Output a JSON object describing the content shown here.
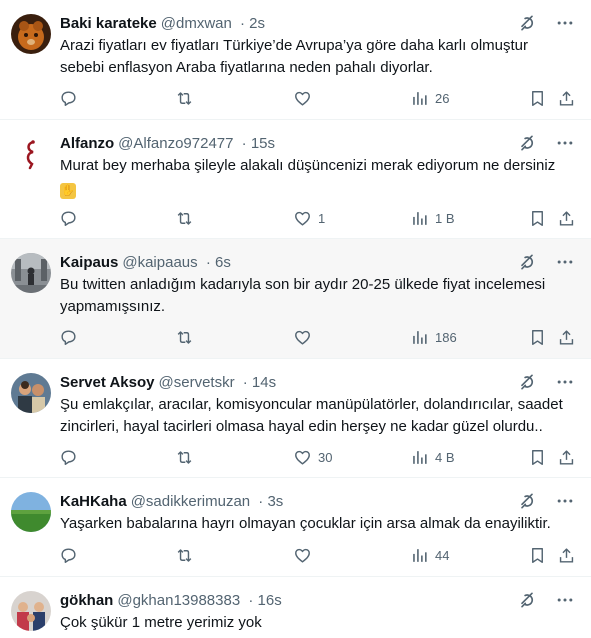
{
  "tweets": [
    {
      "name": "Baki karateke",
      "handle": "@dmxwan",
      "time": "· 2s",
      "text": "Arazi fiyatları ev fiyatları  Türkiye’de Avrupa’ya göre daha karlı olmuştur sebebi enflasyon Araba fiyatlarına neden pahalı diyorlar.",
      "likes": "",
      "views": "26"
    },
    {
      "name": "Alfanzo",
      "handle": "@Alfanzo972477",
      "time": "· 15s",
      "text": "Murat bey merhaba şileyle alakalı düşüncenizi merak ediyorum ne dersiniz",
      "emoji": "folded-hands-emoji",
      "likes": "1",
      "views": "1 B"
    },
    {
      "name": "Kaipaus",
      "handle": "@kaipaaus",
      "time": "· 6s",
      "text": "Bu twitten anladığım kadarıyla son bir aydır 20-25 ülkede fiyat incelemesi yapmamışsınız.",
      "likes": "",
      "views": "186"
    },
    {
      "name": "Servet Aksoy",
      "handle": "@servetskr",
      "time": "· 14s",
      "text": "Şu emlakçılar, aracılar, komisyoncular manüpülatörler, dolandırıcılar, saadet zincirleri, hayal tacirleri olmasa hayal edin herşey ne kadar güzel olurdu..",
      "likes": "30",
      "views": "4 B"
    },
    {
      "name": "KaHKaha",
      "handle": "@sadikkerimuzan",
      "time": "· 3s",
      "text": "Yaşarken babalarına hayrı olmayan çocuklar için arsa almak da enayiliktir.",
      "likes": "",
      "views": "44"
    },
    {
      "name": "gökhan",
      "handle": "@gkhan13988383",
      "time": "· 16s",
      "text": "Çok şükür 1 metre yerimiz yok",
      "likes": "",
      "views": ""
    }
  ],
  "icons": {
    "grok": "grok-icon",
    "more": "more-icon",
    "reply": "reply-icon",
    "retweet": "retweet-icon",
    "like": "like-icon",
    "views": "views-icon",
    "bookmark": "bookmark-icon",
    "share": "share-icon"
  },
  "colors": {
    "text": "#0f1419",
    "muted": "#536471",
    "border": "#eff3f4",
    "highlight": "#f7f7f7"
  }
}
